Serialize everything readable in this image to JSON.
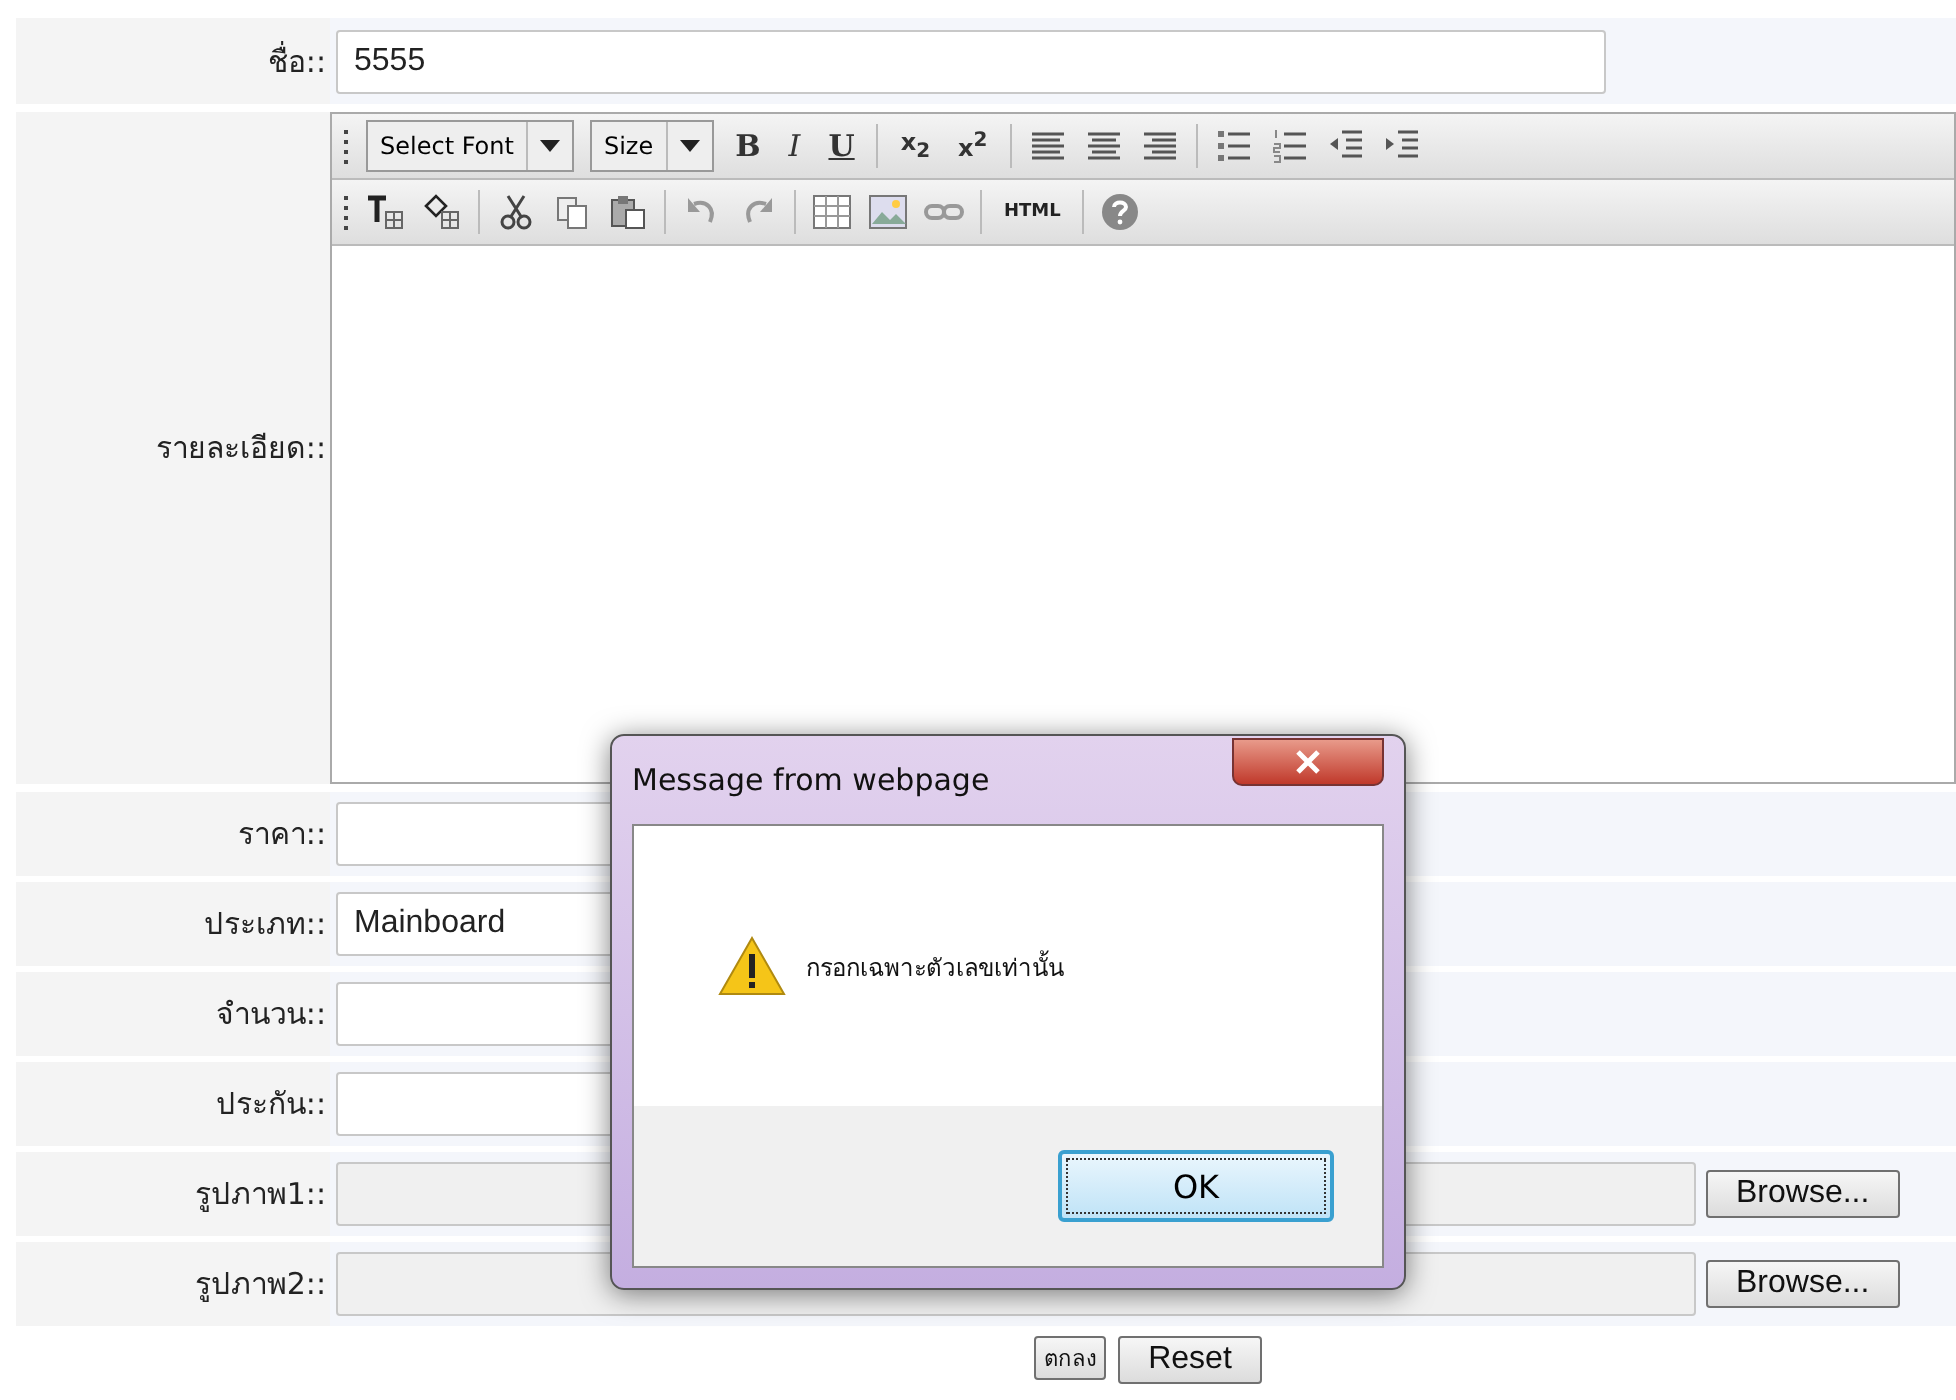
{
  "form": {
    "name_row": {
      "label": "ชื่อ::",
      "value": "5555"
    },
    "editor": {
      "label": "รายละเอียด::",
      "font_dropdown": "Select Font",
      "size_dropdown": "Size",
      "bold": "B",
      "italic": "I",
      "underline": "U",
      "subscript": "x$_{2}$",
      "superscript": "x$^{2}$",
      "html_button": "HTML"
    },
    "fields": [
      {
        "kind": "text",
        "label": "ราคา::"
      },
      {
        "kind": "text",
        "label": "ประเภท::",
        "value": "Mainboard"
      },
      {
        "kind": "text",
        "label": "จำนวน::"
      },
      {
        "kind": "text",
        "label": "ประกัน::"
      },
      {
        "kind": "file",
        "label": "รูปภาพ1::",
        "button": "Browse..."
      },
      {
        "kind": "file",
        "label": "รูปภาพ2::",
        "button": "Browse..."
      }
    ],
    "buttons": [
      "ตกลง",
      "Reset"
    ]
  },
  "dialog": {
    "title": "Message from webpage",
    "message": "กรอกเฉพาะตัวเลขเท่านั้น",
    "ok": "OK"
  }
}
